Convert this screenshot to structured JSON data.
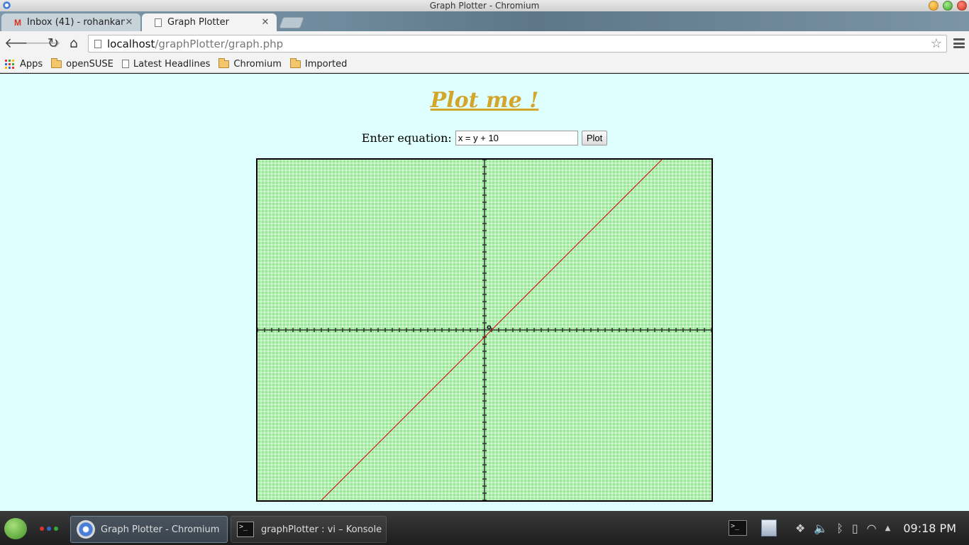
{
  "window": {
    "title": "Graph Plotter - Chromium"
  },
  "tabs": [
    {
      "label": "Inbox (41) - rohankan",
      "icon": "gmail-icon"
    },
    {
      "label": "Graph Plotter",
      "icon": "page-icon"
    }
  ],
  "address_bar": {
    "host": "localhost",
    "path": "/graphPlotter/graph.php"
  },
  "bookmarks": [
    {
      "label": "Apps",
      "icon": "apps-icon"
    },
    {
      "label": "openSUSE",
      "icon": "folder-icon"
    },
    {
      "label": "Latest Headlines",
      "icon": "page-icon"
    },
    {
      "label": "Chromium",
      "icon": "folder-icon"
    },
    {
      "label": "Imported",
      "icon": "folder-icon"
    }
  ],
  "page": {
    "heading": "Plot me !",
    "equation_label": "Enter equation:",
    "equation_value": "x = y + 10",
    "plot_button": "Plot",
    "origin_label": "o"
  },
  "chart_data": {
    "type": "line",
    "title": "",
    "xlabel": "",
    "ylabel": "",
    "xlim": [
      -32,
      32
    ],
    "ylim": [
      -24,
      24
    ],
    "grid": true,
    "series": [
      {
        "x": [
          -23,
          25
        ],
        "y": [
          -24,
          24
        ],
        "color": "#cc0000"
      }
    ],
    "background": "#98e898",
    "grid_color": "#ffffff"
  },
  "taskbar": {
    "tasks": [
      {
        "label": "Graph Plotter - Chromium",
        "icon": "chromium-icon",
        "active": true
      },
      {
        "label": "graphPlotter : vi – Konsole",
        "icon": "konsole-icon",
        "active": false
      }
    ],
    "clock": "09:18 PM"
  },
  "colors": {
    "page_background": "#dfffff",
    "heading": "#d4a52b",
    "plot_line": "#cc0000"
  }
}
